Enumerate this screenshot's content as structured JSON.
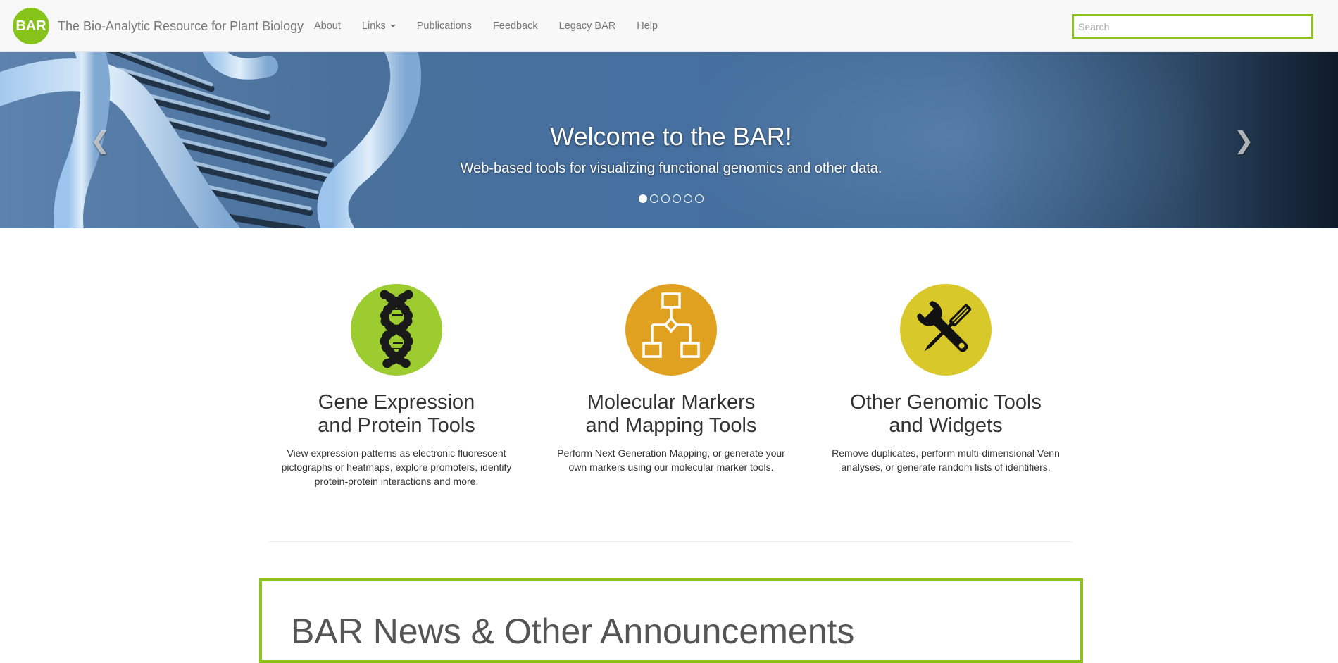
{
  "brand": {
    "logo_text": "BAR",
    "title": "The Bio-Analytic Resource for Plant Biology",
    "logo_color": "#86c41c"
  },
  "nav": {
    "items": [
      {
        "label": "About"
      },
      {
        "label": "Links"
      },
      {
        "label": "Publications"
      },
      {
        "label": "Feedback"
      },
      {
        "label": "Legacy BAR"
      },
      {
        "label": "Help"
      }
    ],
    "search_placeholder": "Search",
    "search_border_color": "#8dc21f"
  },
  "hero": {
    "title": "Welcome to the BAR!",
    "subtitle": "Web-based tools for visualizing functional genomics and other data.",
    "prev_icon": "chevron-left-icon",
    "next_icon": "chevron-right-icon",
    "slide_count": 6,
    "active_slide": 1
  },
  "tools": [
    {
      "title_line1": "Gene Expression",
      "title_line2": "and Protein Tools",
      "description": "View expression patterns as electronic fluorescent pictographs or heatmaps, explore promoters, identify protein-protein interactions and more.",
      "icon": "dna-icon",
      "color": "#9ccc2f"
    },
    {
      "title_line1": "Molecular Markers",
      "title_line2": "and Mapping Tools",
      "description": "Perform Next Generation Mapping, or generate your own markers using our molecular marker tools.",
      "icon": "flowchart-icon",
      "color": "#e0a020"
    },
    {
      "title_line1": "Other Genomic Tools",
      "title_line2": "and Widgets",
      "description": "Remove duplicates, perform multi-dimensional Venn analyses, or generate random lists of identifiers.",
      "icon": "tools-icon",
      "color": "#d9c82a"
    }
  ],
  "news": {
    "title": "BAR News & Other Announcements",
    "border_color": "#8dc21f"
  }
}
